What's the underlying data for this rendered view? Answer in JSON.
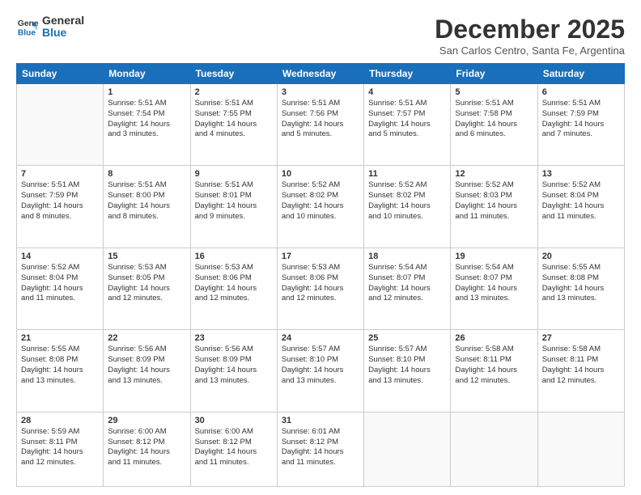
{
  "logo": {
    "line1": "General",
    "line2": "Blue"
  },
  "title": "December 2025",
  "location": "San Carlos Centro, Santa Fe, Argentina",
  "weekdays": [
    "Sunday",
    "Monday",
    "Tuesday",
    "Wednesday",
    "Thursday",
    "Friday",
    "Saturday"
  ],
  "weeks": [
    [
      {
        "day": "",
        "info": ""
      },
      {
        "day": "1",
        "info": "Sunrise: 5:51 AM\nSunset: 7:54 PM\nDaylight: 14 hours\nand 3 minutes."
      },
      {
        "day": "2",
        "info": "Sunrise: 5:51 AM\nSunset: 7:55 PM\nDaylight: 14 hours\nand 4 minutes."
      },
      {
        "day": "3",
        "info": "Sunrise: 5:51 AM\nSunset: 7:56 PM\nDaylight: 14 hours\nand 5 minutes."
      },
      {
        "day": "4",
        "info": "Sunrise: 5:51 AM\nSunset: 7:57 PM\nDaylight: 14 hours\nand 5 minutes."
      },
      {
        "day": "5",
        "info": "Sunrise: 5:51 AM\nSunset: 7:58 PM\nDaylight: 14 hours\nand 6 minutes."
      },
      {
        "day": "6",
        "info": "Sunrise: 5:51 AM\nSunset: 7:59 PM\nDaylight: 14 hours\nand 7 minutes."
      }
    ],
    [
      {
        "day": "7",
        "info": "Sunrise: 5:51 AM\nSunset: 7:59 PM\nDaylight: 14 hours\nand 8 minutes."
      },
      {
        "day": "8",
        "info": "Sunrise: 5:51 AM\nSunset: 8:00 PM\nDaylight: 14 hours\nand 8 minutes."
      },
      {
        "day": "9",
        "info": "Sunrise: 5:51 AM\nSunset: 8:01 PM\nDaylight: 14 hours\nand 9 minutes."
      },
      {
        "day": "10",
        "info": "Sunrise: 5:52 AM\nSunset: 8:02 PM\nDaylight: 14 hours\nand 10 minutes."
      },
      {
        "day": "11",
        "info": "Sunrise: 5:52 AM\nSunset: 8:02 PM\nDaylight: 14 hours\nand 10 minutes."
      },
      {
        "day": "12",
        "info": "Sunrise: 5:52 AM\nSunset: 8:03 PM\nDaylight: 14 hours\nand 11 minutes."
      },
      {
        "day": "13",
        "info": "Sunrise: 5:52 AM\nSunset: 8:04 PM\nDaylight: 14 hours\nand 11 minutes."
      }
    ],
    [
      {
        "day": "14",
        "info": "Sunrise: 5:52 AM\nSunset: 8:04 PM\nDaylight: 14 hours\nand 11 minutes."
      },
      {
        "day": "15",
        "info": "Sunrise: 5:53 AM\nSunset: 8:05 PM\nDaylight: 14 hours\nand 12 minutes."
      },
      {
        "day": "16",
        "info": "Sunrise: 5:53 AM\nSunset: 8:06 PM\nDaylight: 14 hours\nand 12 minutes."
      },
      {
        "day": "17",
        "info": "Sunrise: 5:53 AM\nSunset: 8:06 PM\nDaylight: 14 hours\nand 12 minutes."
      },
      {
        "day": "18",
        "info": "Sunrise: 5:54 AM\nSunset: 8:07 PM\nDaylight: 14 hours\nand 12 minutes."
      },
      {
        "day": "19",
        "info": "Sunrise: 5:54 AM\nSunset: 8:07 PM\nDaylight: 14 hours\nand 13 minutes."
      },
      {
        "day": "20",
        "info": "Sunrise: 5:55 AM\nSunset: 8:08 PM\nDaylight: 14 hours\nand 13 minutes."
      }
    ],
    [
      {
        "day": "21",
        "info": "Sunrise: 5:55 AM\nSunset: 8:08 PM\nDaylight: 14 hours\nand 13 minutes."
      },
      {
        "day": "22",
        "info": "Sunrise: 5:56 AM\nSunset: 8:09 PM\nDaylight: 14 hours\nand 13 minutes."
      },
      {
        "day": "23",
        "info": "Sunrise: 5:56 AM\nSunset: 8:09 PM\nDaylight: 14 hours\nand 13 minutes."
      },
      {
        "day": "24",
        "info": "Sunrise: 5:57 AM\nSunset: 8:10 PM\nDaylight: 14 hours\nand 13 minutes."
      },
      {
        "day": "25",
        "info": "Sunrise: 5:57 AM\nSunset: 8:10 PM\nDaylight: 14 hours\nand 13 minutes."
      },
      {
        "day": "26",
        "info": "Sunrise: 5:58 AM\nSunset: 8:11 PM\nDaylight: 14 hours\nand 12 minutes."
      },
      {
        "day": "27",
        "info": "Sunrise: 5:58 AM\nSunset: 8:11 PM\nDaylight: 14 hours\nand 12 minutes."
      }
    ],
    [
      {
        "day": "28",
        "info": "Sunrise: 5:59 AM\nSunset: 8:11 PM\nDaylight: 14 hours\nand 12 minutes."
      },
      {
        "day": "29",
        "info": "Sunrise: 6:00 AM\nSunset: 8:12 PM\nDaylight: 14 hours\nand 11 minutes."
      },
      {
        "day": "30",
        "info": "Sunrise: 6:00 AM\nSunset: 8:12 PM\nDaylight: 14 hours\nand 11 minutes."
      },
      {
        "day": "31",
        "info": "Sunrise: 6:01 AM\nSunset: 8:12 PM\nDaylight: 14 hours\nand 11 minutes."
      },
      {
        "day": "",
        "info": ""
      },
      {
        "day": "",
        "info": ""
      },
      {
        "day": "",
        "info": ""
      }
    ]
  ]
}
